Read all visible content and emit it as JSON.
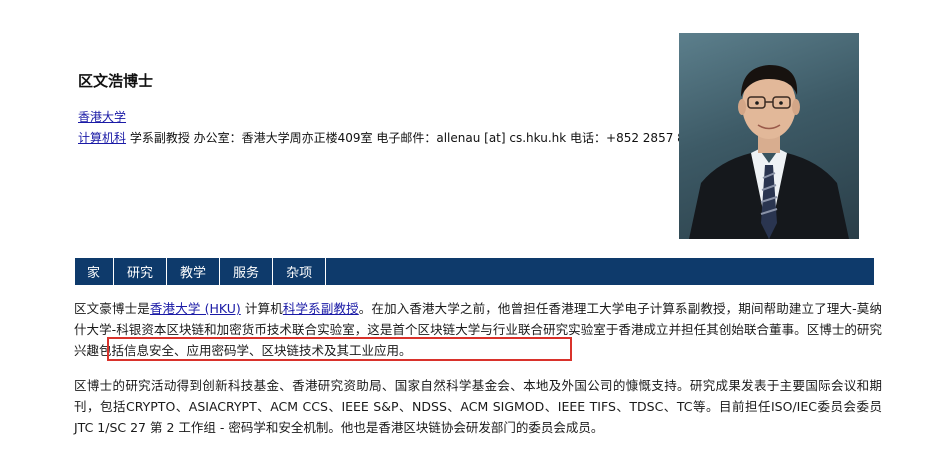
{
  "profile": {
    "name": "区文浩博士",
    "university_link": "香港大学",
    "dept_link": "计算机科",
    "info_rest": " 学系副教授 办公室：香港大学周亦正楼409室 电子邮件：allenau [at] cs.hku.hk 电话：+852 2857 8243"
  },
  "nav": {
    "items": [
      "家",
      "研究",
      "教学",
      "服务",
      "杂项"
    ]
  },
  "bio": {
    "p1_a": "区文豪博士是",
    "p1_link1": "香港大学 (HKU)",
    "p1_b": " 计算机",
    "p1_link2": "科学系副教授",
    "p1_c": "。在加入香港大学之前，他曾担任香港理工大学电子计算系副教授，期间帮助建立了理大-莫纳什大学-科银资本区块链和加密货币技术联合实验室，这是首个区块链大学与行业联合研究实验室于香港成立并担任其创始联合董事。",
    "p1_highlight": "区博士的研究兴趣包括信息安全、应用密码学、区块链技术及其工业应用。",
    "p2": "区博士的研究活动得到创新科技基金、香港研究资助局、国家自然科学基金会、本地及外国公司的慷慨支持。研究成果发表于主要国际会议和期刊，包括CRYPTO、ASIACRYPT、ACM CCS、IEEE S&P、NDSS、ACM SIGMOD、IEEE TIFS、TDSC、TC等。目前担任ISO/IEC委员会委员JTC 1/SC 27 第 2 工作组 - 密码学和安全机制。他也是香港区块链协会研发部门的委员会成员。"
  }
}
